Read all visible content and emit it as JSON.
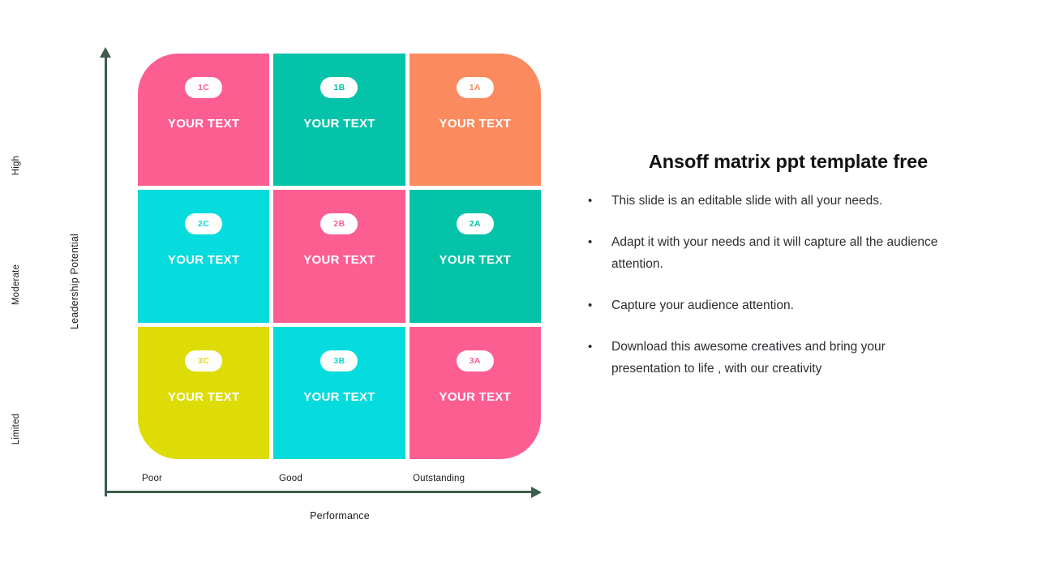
{
  "diagram": {
    "type": "3x3-matrix",
    "axis_color": "#3e5c4b",
    "y_axis": {
      "title": "Leadership Potential",
      "ticks": [
        "High",
        "Moderate",
        "Limited"
      ]
    },
    "x_axis": {
      "title": "Performance",
      "ticks": [
        "Poor",
        "Good",
        "Outstanding"
      ]
    },
    "cells": [
      {
        "badge": "1C",
        "label": "YOUR TEXT",
        "color": "#fd5e92"
      },
      {
        "badge": "1B",
        "label": "YOUR TEXT",
        "color": "#05c3a8"
      },
      {
        "badge": "1A",
        "label": "YOUR TEXT",
        "color": "#fb8a5f"
      },
      {
        "badge": "2C",
        "label": "YOUR TEXT",
        "color": "#06dbdd"
      },
      {
        "badge": "2B",
        "label": "YOUR TEXT",
        "color": "#fd5e92"
      },
      {
        "badge": "2A",
        "label": "YOUR TEXT",
        "color": "#05c3a8"
      },
      {
        "badge": "3C",
        "label": "YOUR TEXT",
        "color": "#dedc07"
      },
      {
        "badge": "3B",
        "label": "YOUR TEXT",
        "color": "#06dbdd"
      },
      {
        "badge": "3A",
        "label": "YOUR TEXT",
        "color": "#fd5e92"
      }
    ]
  },
  "panel": {
    "title": "Ansoff matrix ppt template free",
    "bullet_marker": "•",
    "bullets": [
      "This slide is an editable slide with all your needs.",
      "Adapt it with your needs and it will capture all the audience attention.",
      "Capture your audience attention.",
      "Download this awesome creatives and bring your presentation to life , with our creativity"
    ]
  }
}
